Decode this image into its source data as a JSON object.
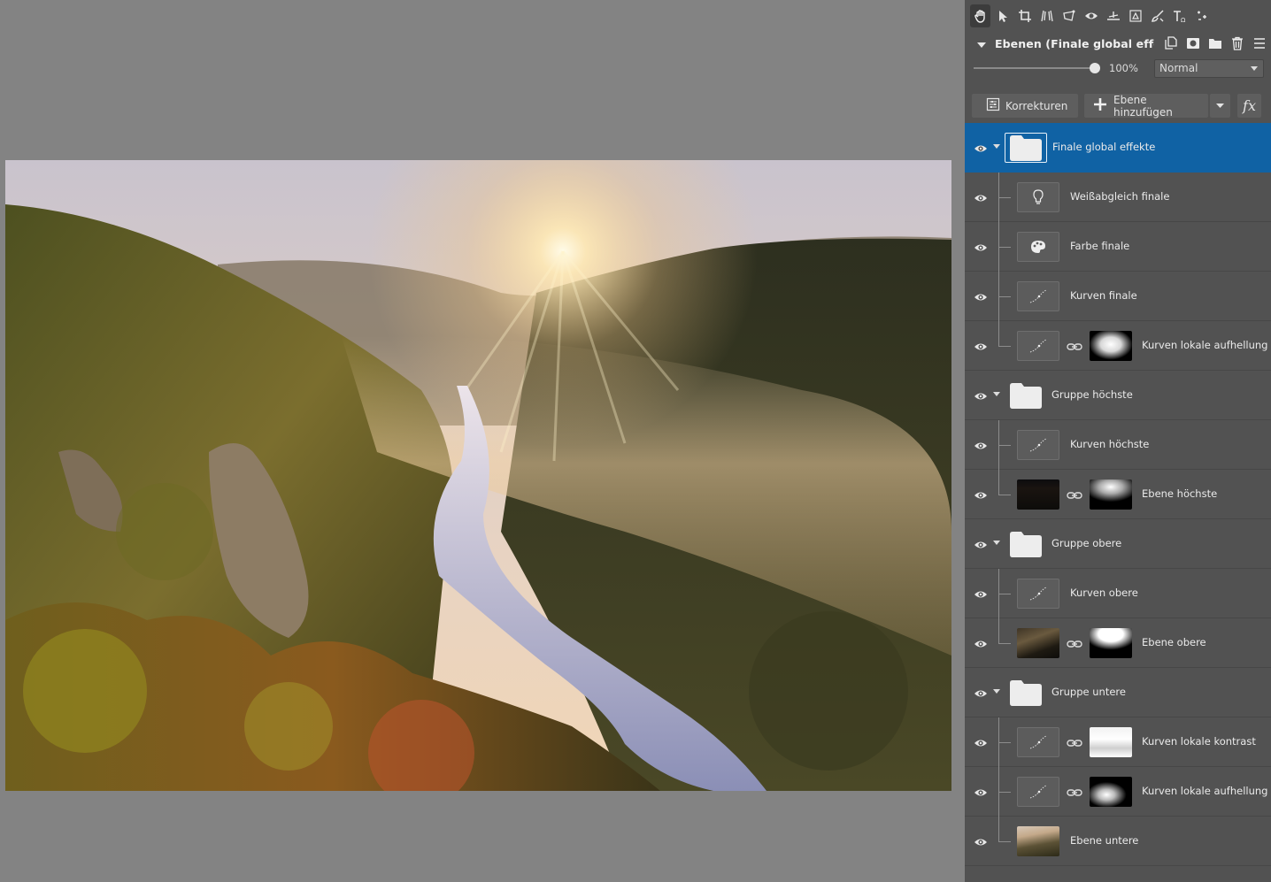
{
  "panel": {
    "toolbar": {
      "tools": [
        "hand-tool-icon",
        "select-tool-icon",
        "crop-tool-icon",
        "perspective-tool-icon",
        "transform-tool-icon",
        "red-eye-tool-icon",
        "straighten-tool-icon",
        "selection-tool-icon",
        "brush-tool-icon",
        "text-tool-icon",
        "more-tools-icon"
      ]
    },
    "layers_header": {
      "title": "Ebenen (Finale global effe..."
    },
    "opacity": {
      "value": "100%",
      "level": 1.0
    },
    "blend_mode": {
      "selected": "Normal"
    },
    "buttons": {
      "corrections": "Korrekturen",
      "add_layer": "Ebene hinzufügen",
      "fx": "fx"
    },
    "layers": [
      {
        "name": "Finale global effekte",
        "kind": "folder",
        "depth": 0,
        "selected": true
      },
      {
        "name": "Weißabgleich finale",
        "kind": "wb",
        "depth": 1
      },
      {
        "name": "Farbe finale",
        "kind": "color",
        "depth": 1
      },
      {
        "name": "Kurven finale",
        "kind": "curves",
        "depth": 1
      },
      {
        "name": "Kurven lokale aufhellung",
        "kind": "curves-mask",
        "depth": 1,
        "last": true
      },
      {
        "name": "Gruppe höchste",
        "kind": "folder",
        "depth": 0
      },
      {
        "name": "Kurven höchste",
        "kind": "curves",
        "depth": 1
      },
      {
        "name": "Ebene höchste",
        "kind": "image-mask",
        "depth": 1,
        "last": true
      },
      {
        "name": "Gruppe obere",
        "kind": "folder",
        "depth": 0
      },
      {
        "name": "Kurven obere",
        "kind": "curves",
        "depth": 1
      },
      {
        "name": "Ebene obere",
        "kind": "image-mask",
        "depth": 1,
        "last": true
      },
      {
        "name": "Gruppe untere",
        "kind": "folder",
        "depth": 0
      },
      {
        "name": "Kurven lokale kontrast",
        "kind": "curves-mask",
        "depth": 1
      },
      {
        "name": "Kurven lokale aufhellung",
        "kind": "curves-mask",
        "depth": 1
      },
      {
        "name": "Ebene untere",
        "kind": "image",
        "depth": 1,
        "last": true
      }
    ]
  },
  "colors": {
    "panel_bg": "#525252",
    "canvas_bg": "#838383",
    "selection": "#1062a4"
  }
}
